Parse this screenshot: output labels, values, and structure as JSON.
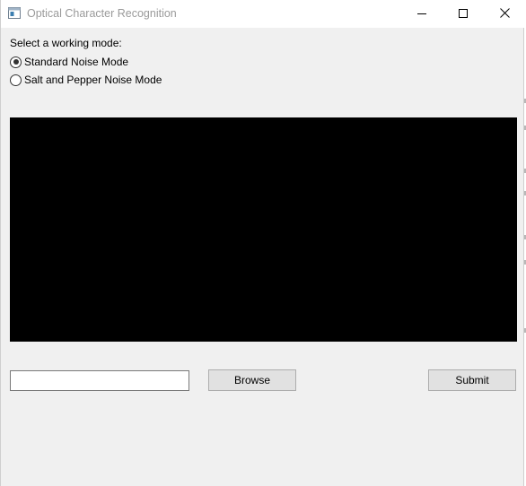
{
  "window": {
    "title": "Optical Character Recognition",
    "icons": {
      "app": "app-window-icon",
      "minimize": "minimize-icon",
      "maximize": "maximize-icon",
      "close": "close-icon"
    }
  },
  "mode": {
    "prompt": "Select a working mode:",
    "options": [
      {
        "label": "Standard Noise Mode",
        "selected": true
      },
      {
        "label": "Salt and Pepper Noise Mode",
        "selected": false
      }
    ]
  },
  "preview": {
    "background": "#000000"
  },
  "file": {
    "path_value": "",
    "browse_label": "Browse",
    "submit_label": "Submit"
  },
  "colors": {
    "window_bg": "#f0f0f0",
    "titlebar_bg": "#ffffff",
    "button_bg": "#e1e1e1"
  }
}
